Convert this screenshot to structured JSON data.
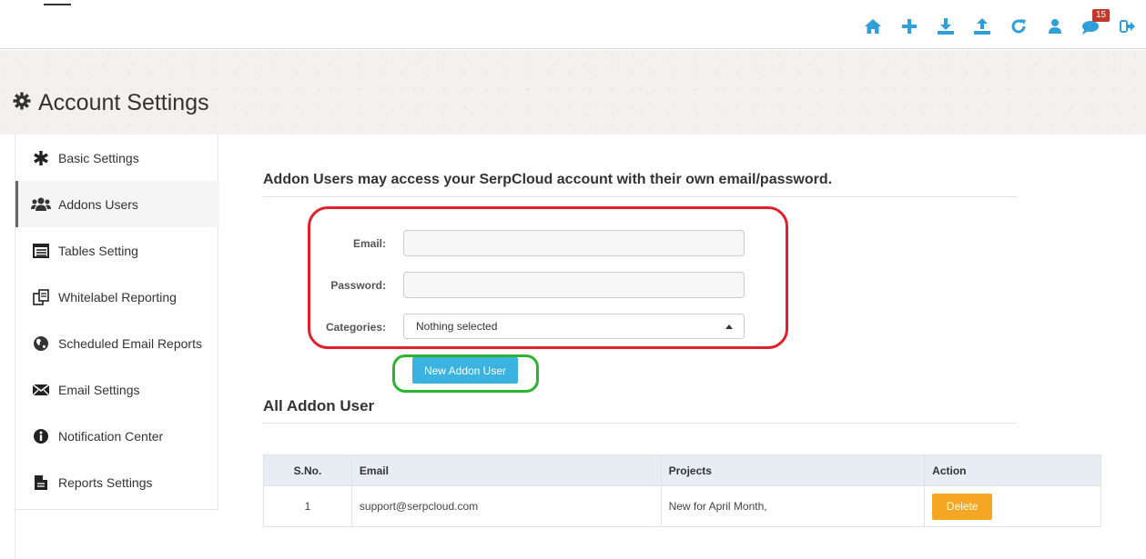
{
  "header": {
    "title": "Account Settings",
    "icons": [
      "home-icon",
      "plus-icon",
      "download-icon",
      "upload-icon",
      "refresh-icon",
      "user-icon",
      "comments-icon",
      "logout-icon"
    ],
    "notification_count": "15"
  },
  "sidebar": {
    "items": [
      {
        "label": "Basic Settings",
        "icon": "asterisk-icon"
      },
      {
        "label": "Addons Users",
        "icon": "users-icon",
        "active": true
      },
      {
        "label": "Tables Setting",
        "icon": "table-icon"
      },
      {
        "label": "Whitelabel Reporting",
        "icon": "copy-icon"
      },
      {
        "label": "Scheduled Email Reports",
        "icon": "globe-icon"
      },
      {
        "label": "Email Settings",
        "icon": "envelope-icon"
      },
      {
        "label": "Notification Center",
        "icon": "info-icon"
      },
      {
        "label": "Reports Settings",
        "icon": "file-icon"
      }
    ]
  },
  "main": {
    "heading": "Addon Users may access your SerpCloud account with their own email/password.",
    "form": {
      "email_label": "Email:",
      "email_value": "",
      "password_label": "Password:",
      "password_value": "",
      "categories_label": "Categories:",
      "categories_value": "Nothing selected"
    },
    "new_button": "New Addon User",
    "list_heading": "All Addon User",
    "table": {
      "headers": [
        "S.No.",
        "Email",
        "Projects",
        "Action"
      ],
      "rows": [
        {
          "sno": "1",
          "email": "support@serpcloud.com",
          "projects": "New for April Month,",
          "action": "Delete"
        }
      ]
    }
  },
  "colors": {
    "accent_blue": "#3bb3e0",
    "delete_orange": "#f5a623",
    "highlight_red": "#e0212b",
    "highlight_green": "#2cb52c",
    "badge_red": "#c0392b"
  }
}
